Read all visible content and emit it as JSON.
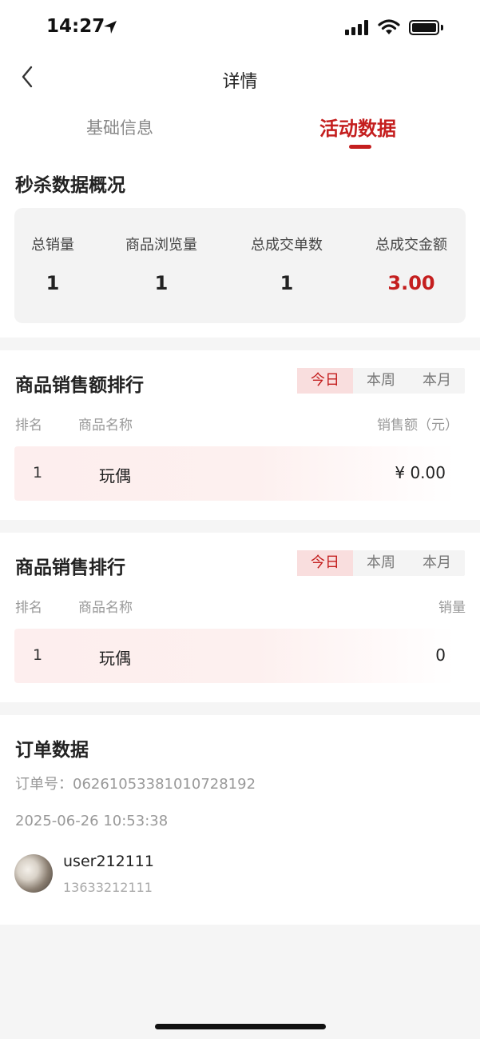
{
  "status_bar": {
    "time": "14:27"
  },
  "nav": {
    "title": "详情"
  },
  "tabs": [
    {
      "label": "基础信息",
      "active": false
    },
    {
      "label": "活动数据",
      "active": true
    }
  ],
  "overview": {
    "title": "秒杀数据概况",
    "stats": [
      {
        "label": "总销量",
        "value": "1"
      },
      {
        "label": "商品浏览量",
        "value": "1"
      },
      {
        "label": "总成交单数",
        "value": "1"
      },
      {
        "label": "总成交金额",
        "value": "3.00"
      }
    ]
  },
  "sales_amount_ranking": {
    "title": "商品销售额排行",
    "periods": [
      "今日",
      "本周",
      "本月"
    ],
    "active_period": "今日",
    "columns": {
      "rank": "排名",
      "name": "商品名称",
      "value": "销售额（元）"
    },
    "rows": [
      {
        "rank": "1",
        "name": "玩偶",
        "value": "¥ 0.00"
      }
    ]
  },
  "sales_count_ranking": {
    "title": "商品销售排行",
    "periods": [
      "今日",
      "本周",
      "本月"
    ],
    "active_period": "今日",
    "columns": {
      "rank": "排名",
      "name": "商品名称",
      "value": "销量"
    },
    "rows": [
      {
        "rank": "1",
        "name": "玩偶",
        "value": "0"
      }
    ]
  },
  "orders": {
    "title": "订单数据",
    "order_no_label": "订单号：0626105338101072819​2",
    "datetime": "2025-06-26 10:53:38",
    "user": {
      "name": "user212111",
      "phone": "13633212111"
    }
  },
  "colors": {
    "accent": "#c41e1e",
    "background": "#f5f5f5"
  }
}
